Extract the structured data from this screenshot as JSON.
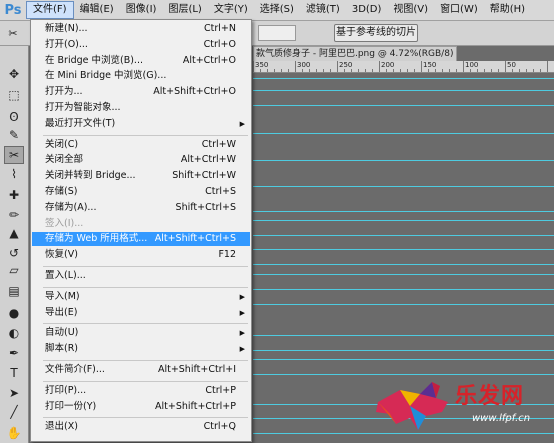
{
  "app": {
    "logo": "Ps"
  },
  "menubar": [
    {
      "label": "文件(F)",
      "active": true
    },
    {
      "label": "编辑(E)"
    },
    {
      "label": "图像(I)"
    },
    {
      "label": "图层(L)"
    },
    {
      "label": "文字(Y)"
    },
    {
      "label": "选择(S)"
    },
    {
      "label": "滤镜(T)"
    },
    {
      "label": "3D(D)"
    },
    {
      "label": "视图(V)"
    },
    {
      "label": "窗口(W)"
    },
    {
      "label": "帮助(H)"
    }
  ],
  "options_bar": {
    "button_label": "基于参考线的切片"
  },
  "document": {
    "tab_title": "款气质修身子 - 阿里巴巴.png @ 4.72%(RGB/8) *"
  },
  "ruler": {
    "labels": [
      "350",
      "300",
      "250",
      "200",
      "150",
      "100",
      "50"
    ]
  },
  "file_menu": [
    {
      "label": "新建(N)...",
      "shortcut": "Ctrl+N"
    },
    {
      "label": "打开(O)...",
      "shortcut": "Ctrl+O"
    },
    {
      "label": "在 Bridge 中浏览(B)...",
      "shortcut": "Alt+Ctrl+O"
    },
    {
      "label": "在 Mini Bridge 中浏览(G)...",
      "shortcut": ""
    },
    {
      "label": "打开为...",
      "shortcut": "Alt+Shift+Ctrl+O"
    },
    {
      "label": "打开为智能对象...",
      "shortcut": ""
    },
    {
      "label": "最近打开文件(T)",
      "shortcut": "",
      "submenu": true
    },
    {
      "separator": true
    },
    {
      "label": "关闭(C)",
      "shortcut": "Ctrl+W"
    },
    {
      "label": "关闭全部",
      "shortcut": "Alt+Ctrl+W"
    },
    {
      "label": "关闭并转到 Bridge...",
      "shortcut": "Shift+Ctrl+W"
    },
    {
      "label": "存储(S)",
      "shortcut": "Ctrl+S"
    },
    {
      "label": "存储为(A)...",
      "shortcut": "Shift+Ctrl+S"
    },
    {
      "label": "签入(I)...",
      "shortcut": "",
      "disabled": true
    },
    {
      "label": "存储为 Web 所用格式...",
      "shortcut": "Alt+Shift+Ctrl+S",
      "highlight": true
    },
    {
      "label": "恢复(V)",
      "shortcut": "F12"
    },
    {
      "separator": true
    },
    {
      "label": "置入(L)...",
      "shortcut": ""
    },
    {
      "separator": true
    },
    {
      "label": "导入(M)",
      "shortcut": "",
      "submenu": true
    },
    {
      "label": "导出(E)",
      "shortcut": "",
      "submenu": true
    },
    {
      "separator": true
    },
    {
      "label": "自动(U)",
      "shortcut": "",
      "submenu": true
    },
    {
      "label": "脚本(R)",
      "shortcut": "",
      "submenu": true
    },
    {
      "separator": true
    },
    {
      "label": "文件简介(F)...",
      "shortcut": "Alt+Shift+Ctrl+I"
    },
    {
      "separator": true
    },
    {
      "label": "打印(P)...",
      "shortcut": "Ctrl+P"
    },
    {
      "label": "打印一份(Y)",
      "shortcut": "Alt+Shift+Ctrl+P"
    },
    {
      "separator": true
    },
    {
      "label": "退出(X)",
      "shortcut": "Ctrl+Q"
    }
  ],
  "tools": [
    "move-icon",
    "marquee-icon",
    "lasso-icon",
    "quick-select-icon",
    "slice-icon",
    "eyedropper-icon",
    "healing-brush-icon",
    "brush-icon",
    "clone-stamp-icon",
    "history-brush-icon",
    "eraser-icon",
    "gradient-icon",
    "blur-icon",
    "dodge-icon",
    "pen-icon",
    "type-icon",
    "path-select-icon",
    "line-icon",
    "hand-icon"
  ],
  "tool_glyphs": [
    "✥",
    "⬚",
    "ʘ",
    "✎",
    "✂",
    "⌇",
    "✚",
    "✏",
    "▲",
    "↺",
    "▱",
    "▤",
    "●",
    "◐",
    "✒",
    "T",
    "➤",
    "╱",
    "✋"
  ],
  "watermark": {
    "text": "乐发网",
    "url": "www.lfpf.cn"
  },
  "colors": {
    "highlight": "#3399ff",
    "guide": "#4ecbe0",
    "brand_red": "#d6232a"
  }
}
